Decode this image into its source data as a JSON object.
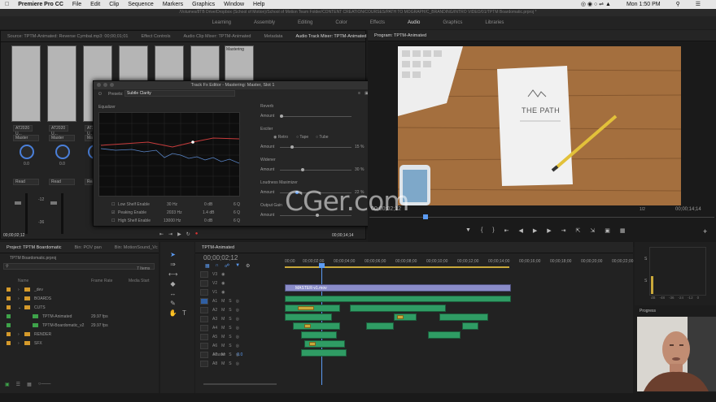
{
  "menubar": {
    "app": "Premiere Pro CC",
    "items": [
      "File",
      "Edit",
      "Clip",
      "Sequence",
      "Markers",
      "Graphics",
      "Window",
      "Help"
    ],
    "clock": "Mon 1:50 PM"
  },
  "path": "/Volumes/8TB Drive/Dropbox (School of Motion)/School of Motion Team Folder/CONTENT CREATION/COURSES/PATH TO MOGRAPH/C_BRANDING/INTRO VIDEO/01/TPTM Boardomatic.prproj *",
  "workspaces": [
    "Learning",
    "Assembly",
    "Editing",
    "Color",
    "Effects",
    "Audio",
    "Graphics",
    "Libraries"
  ],
  "workspace_active": "Audio",
  "top_tabs": [
    "Source: TPTM-Animated: Reverse Cymbal.mp3: 00;00;01;01",
    "Effect Controls",
    "Audio Clip Mixer: TPTM-Animated",
    "Metadata",
    "Audio Track Mixer: TPTM-Animated"
  ],
  "mixer": {
    "mastering_label": "Mastering",
    "channels": [
      {
        "input": "AT2020 U...",
        "output": "Master",
        "value": "0.0",
        "mode": "Read"
      },
      {
        "input": "AT2020 U...",
        "output": "Master",
        "value": "0.0",
        "mode": "Read"
      },
      {
        "input": "AT2020 U...",
        "output": "Master",
        "value": "0.0",
        "mode": "Read"
      }
    ],
    "meter_scale": [
      "-12",
      "-36"
    ]
  },
  "fx_editor": {
    "title": "Track Fx Editor - Mastering: Master, Slot 1",
    "presets_label": "Presets:",
    "preset_value": "Subtle Clarity",
    "eq_label": "Equalizer",
    "eq_rows": [
      {
        "label": "Low Shelf Enable",
        "hz": "30 Hz",
        "db": "0 dB",
        "q": "6 Q",
        "checked": false
      },
      {
        "label": "Peaking Enable",
        "hz": "2033 Hz",
        "db": "1.4 dB",
        "q": "6 Q",
        "checked": true
      },
      {
        "label": "High Shelf Enable",
        "hz": "13000 Hz",
        "db": "0 dB",
        "q": "6 Q",
        "checked": false
      }
    ],
    "reverb_label": "Reverb",
    "reverb_amount": "",
    "exciter_label": "Exciter",
    "exciter_modes": [
      "Retro",
      "Tape",
      "Tube"
    ],
    "exciter_amount": "15 %",
    "widener_label": "Widener",
    "widener_amount": "30 %",
    "loudness_label": "Loudness Maximizer",
    "loudness_amount": "22 %",
    "output_gain_label": "Output Gain",
    "amount_label": "Amount",
    "scale": [
      "0",
      "10",
      "20",
      "30",
      "40",
      "50",
      "60",
      "70",
      "80",
      "90",
      "100"
    ]
  },
  "program": {
    "tab": "Program: TPTM-Animated",
    "timecode": "00;00;02;12",
    "duration": "00;00;14;14",
    "fraction": "1/2",
    "paper_title": "THE PATH"
  },
  "watermark": "CGer.com",
  "source_timecode_left": "00;00;02;12",
  "source_timecode_right": "00;00;14;14",
  "project": {
    "tabs": [
      "Project: TPTM Boardomatic",
      "Bin: POV pan",
      "Bin: MotionSound_Vc"
    ],
    "file": "TPTM Boardomatic.prproj",
    "items_count": "7 Items",
    "columns": [
      "Name",
      "Frame Rate",
      "Media Start"
    ],
    "rows": [
      {
        "name": "_dev",
        "fps": "",
        "type": "folder"
      },
      {
        "name": "BOARDS",
        "fps": "",
        "type": "folder"
      },
      {
        "name": "CUTS",
        "fps": "",
        "type": "folder"
      },
      {
        "name": "TPTM-Animated",
        "fps": "29.97 fps",
        "type": "seq"
      },
      {
        "name": "TPTM-Boardomatic_v2",
        "fps": "29.97 fps",
        "type": "seq"
      },
      {
        "name": "RENDER",
        "fps": "",
        "type": "folder"
      },
      {
        "name": "SFX",
        "fps": "",
        "type": "folder"
      }
    ]
  },
  "timeline": {
    "tab": "TPTM-Animated",
    "timecode": "00;00;02;12",
    "ruler": [
      "00;00",
      "00;00;02;00",
      "00;00;04;00",
      "00;00;06;00",
      "00;00;08;00",
      "00;00;10;00",
      "00;00;12;00",
      "00;00;14;00",
      "00;00;16;00",
      "00;00;18;00",
      "00;00;20;00",
      "00;00;22;00"
    ],
    "video_tracks": [
      "V3",
      "V2",
      "V1"
    ],
    "audio_tracks": [
      "A1",
      "A2",
      "A3",
      "A4",
      "A5",
      "A6",
      "A7",
      "A8"
    ],
    "master_label": "Master",
    "master_value": "0.0",
    "clip_label": "MASTER-v1.mov"
  },
  "meters_scale": [
    "dB",
    "-48",
    "-36",
    "-24",
    "-12",
    "0"
  ],
  "meters_labels": [
    "S",
    "S"
  ],
  "progress_label": "Progress"
}
